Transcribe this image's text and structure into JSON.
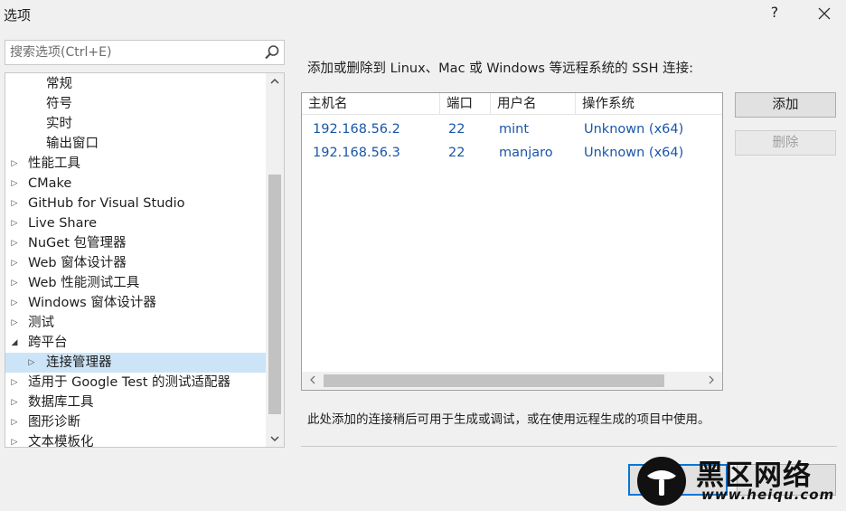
{
  "window": {
    "title": "选项",
    "help_label": "?"
  },
  "search": {
    "placeholder": "搜索选项(Ctrl+E)"
  },
  "tree": {
    "items": [
      {
        "label": "常规",
        "expander": "",
        "level": 1
      },
      {
        "label": "符号",
        "expander": "",
        "level": 1
      },
      {
        "label": "实时",
        "expander": "",
        "level": 1
      },
      {
        "label": "输出窗口",
        "expander": "",
        "level": 1
      },
      {
        "label": "性能工具",
        "expander": "▷",
        "level": 0
      },
      {
        "label": "CMake",
        "expander": "▷",
        "level": 0
      },
      {
        "label": "GitHub for Visual Studio",
        "expander": "▷",
        "level": 0
      },
      {
        "label": "Live Share",
        "expander": "▷",
        "level": 0
      },
      {
        "label": "NuGet 包管理器",
        "expander": "▷",
        "level": 0
      },
      {
        "label": "Web 窗体设计器",
        "expander": "▷",
        "level": 0
      },
      {
        "label": "Web 性能测试工具",
        "expander": "▷",
        "level": 0
      },
      {
        "label": "Windows 窗体设计器",
        "expander": "▷",
        "level": 0
      },
      {
        "label": "测试",
        "expander": "▷",
        "level": 0
      },
      {
        "label": "跨平台",
        "expander": "◢",
        "level": 0
      },
      {
        "label": "连接管理器",
        "expander": "▷",
        "level": 1,
        "selected": true
      },
      {
        "label": "适用于 Google Test 的测试适配器",
        "expander": "▷",
        "level": 0
      },
      {
        "label": "数据库工具",
        "expander": "▷",
        "level": 0
      },
      {
        "label": "图形诊断",
        "expander": "▷",
        "level": 0
      },
      {
        "label": "文本模板化",
        "expander": "▷",
        "level": 0
      }
    ]
  },
  "main": {
    "description": "添加或删除到 Linux、Mac 或 Windows 等远程系统的 SSH 连接:",
    "columns": [
      "主机名",
      "端口",
      "用户名",
      "操作系统"
    ],
    "rows": [
      [
        "192.168.56.2",
        "22",
        "mint",
        "Unknown (x64)"
      ],
      [
        "192.168.56.3",
        "22",
        "manjaro",
        "Unknown (x64)"
      ]
    ],
    "add_label": "添加",
    "remove_label": "删除",
    "note": "此处添加的连接稍后可用于生成或调试，或在使用远程生成的项目中使用。"
  },
  "watermark": {
    "text": "黑区网络",
    "url": "www.heiqu.com"
  },
  "colors": {
    "selection": "#cce4f7",
    "link_text": "#1a56a8",
    "accent": "#0078d7"
  },
  "icons": [
    "close-icon",
    "search-icon",
    "chevron-up-icon",
    "chevron-down-icon",
    "chevron-left-icon",
    "chevron-right-icon",
    "tree-expander-icon"
  ]
}
